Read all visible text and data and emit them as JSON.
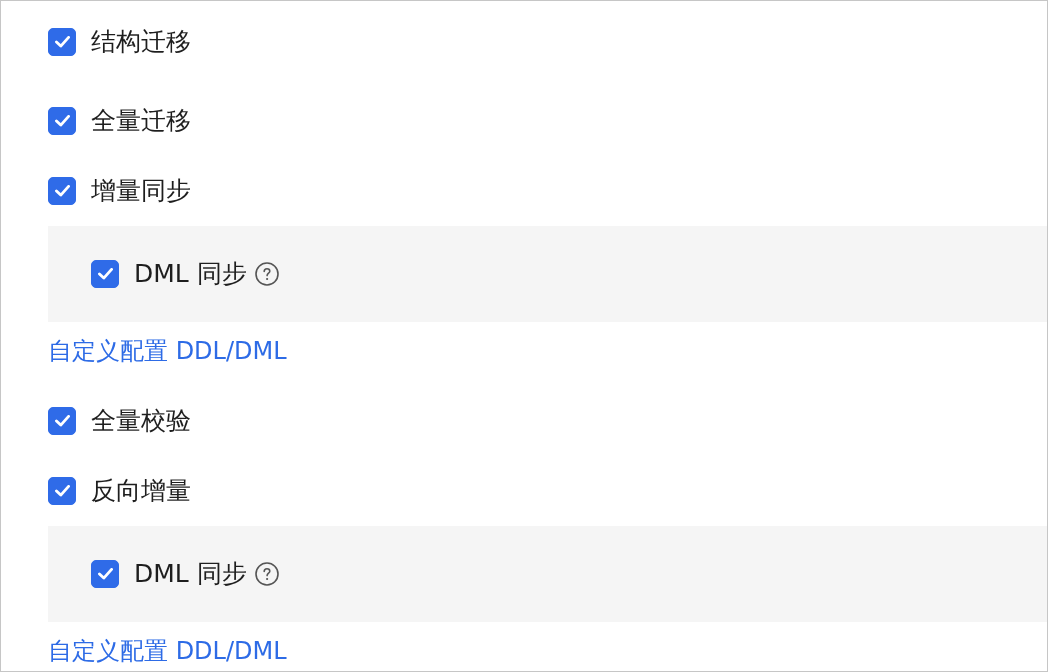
{
  "options": [
    {
      "label": "结构迁移",
      "checked": true
    },
    {
      "label": "全量迁移",
      "checked": true
    },
    {
      "label": "增量同步",
      "checked": true,
      "children": [
        {
          "label": "DML 同步",
          "checked": true
        }
      ],
      "link": "自定义配置 DDL/DML"
    },
    {
      "label": "全量校验",
      "checked": true
    },
    {
      "label": "反向增量",
      "checked": true,
      "children": [
        {
          "label": "DML 同步",
          "checked": true
        }
      ],
      "link": "自定义配置 DDL/DML"
    }
  ]
}
